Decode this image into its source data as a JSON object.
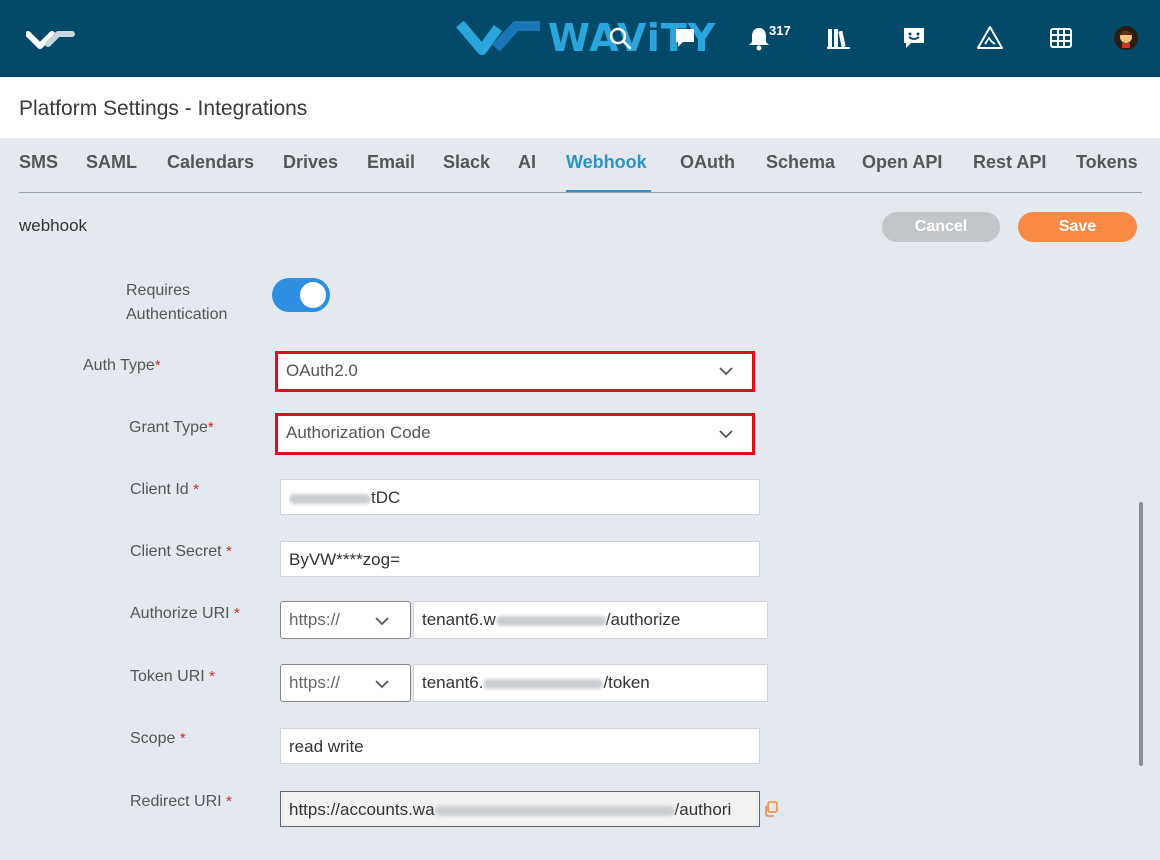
{
  "topbar": {
    "brand_text": "WAViTY",
    "notification_count": "317",
    "icons": [
      "logo-check-icon",
      "search-icon",
      "chat-icon",
      "bell-icon",
      "library-icon",
      "feedback-icon",
      "warning-icon",
      "grid-icon",
      "avatar"
    ]
  },
  "page": {
    "title": "Platform Settings - Integrations"
  },
  "tabs": [
    {
      "label": "SMS",
      "active": false
    },
    {
      "label": "SAML",
      "active": false
    },
    {
      "label": "Calendars",
      "active": false
    },
    {
      "label": "Drives",
      "active": false
    },
    {
      "label": "Email",
      "active": false
    },
    {
      "label": "Slack",
      "active": false
    },
    {
      "label": "AI",
      "active": false
    },
    {
      "label": "Webhook",
      "active": true
    },
    {
      "label": "OAuth",
      "active": false
    },
    {
      "label": "Schema",
      "active": false
    },
    {
      "label": "Open API",
      "active": false
    },
    {
      "label": "Rest API",
      "active": false
    },
    {
      "label": "Tokens",
      "active": false
    }
  ],
  "section": {
    "label": "webhook",
    "cancel_label": "Cancel",
    "save_label": "Save"
  },
  "form": {
    "requires_auth": {
      "label_line1": "Requires",
      "label_line2": "Authentication",
      "enabled": true
    },
    "auth_type": {
      "label": "Auth Type",
      "value": "OAuth2.0"
    },
    "grant_type": {
      "label": "Grant Type",
      "value": "Authorization Code"
    },
    "client_id": {
      "label": "Client Id",
      "value_suffix": "tDC"
    },
    "client_secret": {
      "label": "Client Secret",
      "value": "ByVW****zog="
    },
    "authorize_uri": {
      "label": "Authorize URI",
      "protocol": "https://",
      "value_prefix": "tenant6.w",
      "value_suffix": "/authorize"
    },
    "token_uri": {
      "label": "Token URI",
      "protocol": "https://",
      "value_prefix": "tenant6.",
      "value_suffix": "/token"
    },
    "scope": {
      "label": "Scope",
      "value": "read write"
    },
    "redirect_uri": {
      "label": "Redirect URI",
      "value_prefix": "https://accounts.wa",
      "value_suffix": "/authori"
    },
    "required_mark": "*"
  },
  "colors": {
    "topbar": "#034a6a",
    "accent": "#2b93c8",
    "save": "#f98a45",
    "cancel": "#c3c6c9",
    "highlight": "#e00d1a"
  }
}
